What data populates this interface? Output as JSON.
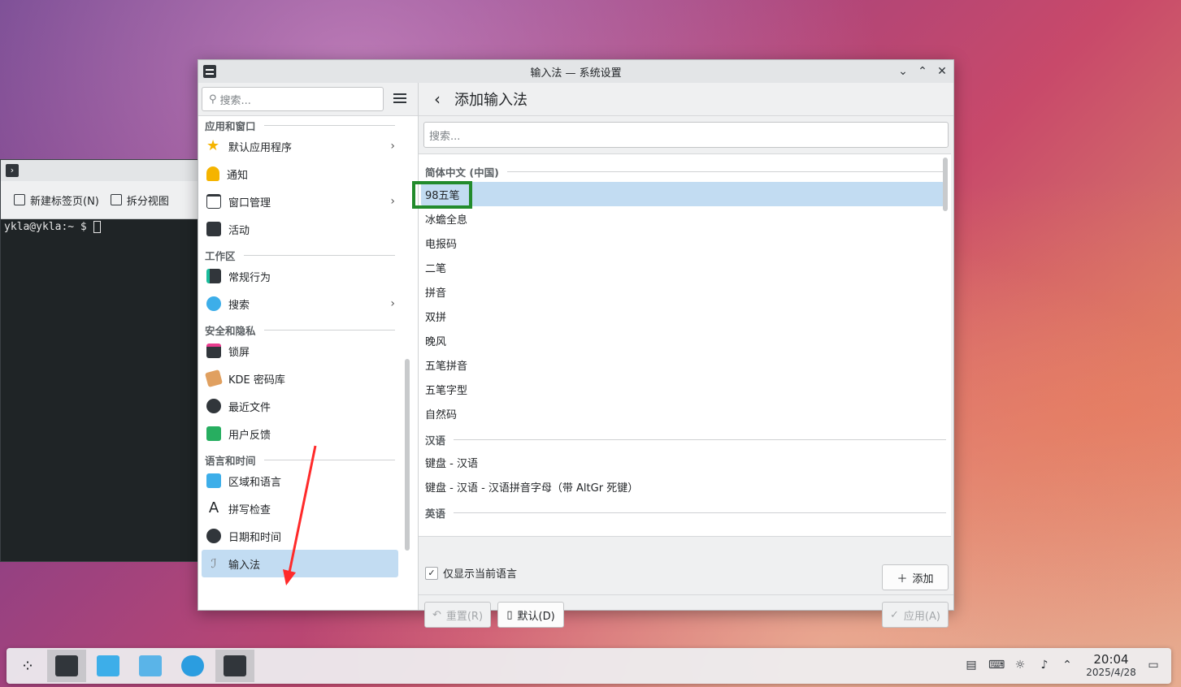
{
  "window": {
    "title": "输入法 — 系统设置"
  },
  "terminal": {
    "new_tab": "新建标签页(N)",
    "split_view": "拆分视图",
    "prompt": "ykla@ykla:~ $"
  },
  "sidebar": {
    "search_placeholder": "搜索...",
    "sections": [
      {
        "title": "应用和窗口",
        "items": [
          {
            "label": "默认应用程序",
            "icon": "star-icon"
          },
          {
            "label": "通知",
            "icon": "bell-icon"
          },
          {
            "label": "窗口管理",
            "icon": "window-icon"
          },
          {
            "label": "活动",
            "icon": "activities-icon"
          }
        ]
      },
      {
        "title": "工作区",
        "items": [
          {
            "label": "常规行为",
            "icon": "sliders-icon"
          },
          {
            "label": "搜索",
            "icon": "search-icon"
          }
        ]
      },
      {
        "title": "安全和隐私",
        "items": [
          {
            "label": "锁屏",
            "icon": "lock-screen-icon"
          },
          {
            "label": "KDE 密码库",
            "icon": "wallet-icon"
          },
          {
            "label": "最近文件",
            "icon": "clock-icon"
          },
          {
            "label": "用户反馈",
            "icon": "feedback-icon"
          }
        ]
      },
      {
        "title": "语言和时间",
        "items": [
          {
            "label": "区域和语言",
            "icon": "region-icon"
          },
          {
            "label": "拼写检查",
            "icon": "spell-icon"
          },
          {
            "label": "日期和时间",
            "icon": "clock-icon"
          },
          {
            "label": "输入法",
            "icon": "input-method-icon"
          }
        ]
      }
    ]
  },
  "main": {
    "title": "添加输入法",
    "search_placeholder": "搜索...",
    "groups": [
      {
        "title": "简体中文 (中国)",
        "items": [
          "98五笔",
          "冰蟾全息",
          "电报码",
          "二笔",
          "拼音",
          "双拼",
          "晚风",
          "五笔拼音",
          "五笔字型",
          "自然码"
        ]
      },
      {
        "title": "汉语",
        "items": [
          "键盘 - 汉语",
          "键盘 - 汉语 - 汉语拼音字母（带 AltGr 死键）"
        ]
      },
      {
        "title": "英语",
        "items": []
      }
    ],
    "show_current_lang": "仅显示当前语言",
    "add": "添加",
    "reset": "重置(R)",
    "default": "默认(D)",
    "apply": "应用(A)"
  },
  "taskbar": {
    "time": "20:04",
    "date": "2025/4/28"
  },
  "colors": {
    "selection": "#c2dcf2",
    "highlight_box": "#228b2c",
    "arrow": "#ff2a2a"
  }
}
